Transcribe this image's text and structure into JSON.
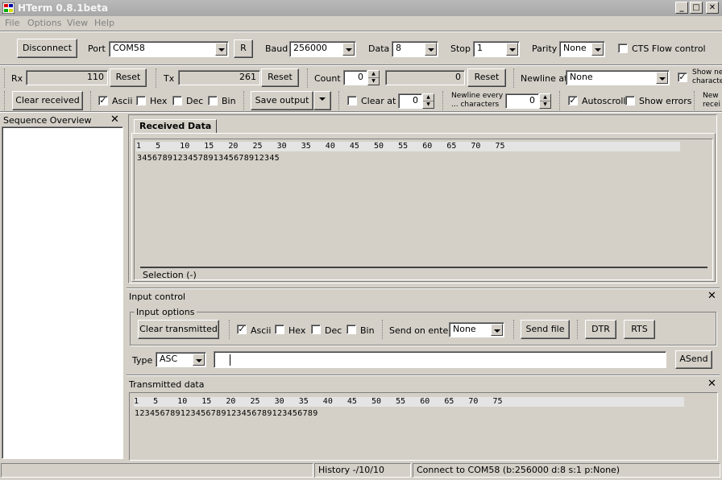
{
  "window": {
    "title": "HTerm 0.8.1beta",
    "min": "_",
    "max": "□",
    "close": "✕"
  },
  "menu": [
    "File",
    "Options",
    "View",
    "Help"
  ],
  "conn": {
    "disconnect": "Disconnect",
    "port_label": "Port",
    "port": "COM58",
    "r": "R",
    "baud_label": "Baud",
    "baud": "256000",
    "data_label": "Data",
    "data": "8",
    "stop_label": "Stop",
    "stop": "1",
    "parity_label": "Parity",
    "parity": "None",
    "cts": "CTS Flow control"
  },
  "counters": {
    "rx_label": "Rx",
    "rx": "110",
    "rx_reset": "Reset",
    "tx_label": "Tx",
    "tx": "261",
    "tx_reset": "Reset",
    "count_label": "Count",
    "count": "0",
    "count_value": "0",
    "count_reset": "Reset",
    "newline_label": "Newline at",
    "newline": "None",
    "show_newline": "Show ne\ncharacte"
  },
  "display": {
    "clear_received": "Clear received",
    "ascii": "Ascii",
    "hex": "Hex",
    "dec": "Dec",
    "bin": "Bin",
    "save_output": "Save output",
    "clear_at": "Clear at",
    "clear_at_value": "0",
    "newline_every": "Newline every\n... characters",
    "newline_every_value": "0",
    "autoscroll": "Autoscroll",
    "show_errors": "Show errors",
    "new_recv": "New\nrecei"
  },
  "sequence": {
    "title": "Sequence Overview",
    "close": "✕"
  },
  "received": {
    "tab": "Received Data",
    "ruler": "1   5    10   15   20   25   30   35   40   45   50   55   60   65   70   75  ",
    "data": "3456789123457891345678912345",
    "selection": "Selection (-)"
  },
  "input_control": {
    "title": "Input control",
    "close": "✕",
    "group": "Input options",
    "clear_transmitted": "Clear transmitted",
    "ascii": "Ascii",
    "hex": "Hex",
    "dec": "Dec",
    "bin": "Bin",
    "send_on_enter_label": "Send on enter",
    "send_on_enter": "None",
    "send_file": "Send file",
    "dtr": "DTR",
    "rts": "RTS",
    "type_label": "Type",
    "type": "ASC",
    "input_value": "",
    "asend": "ASend"
  },
  "transmitted": {
    "title": "Transmitted data",
    "close": "✕",
    "ruler": "1   5    10   15   20   25   30   35   40   45   50   55   60   65   70   75   ",
    "data": "123456789123456789123456789123456789"
  },
  "status": {
    "history": "History -/10/10",
    "connect": "Connect to COM58 (b:256000 d:8 s:1 p:None)"
  }
}
